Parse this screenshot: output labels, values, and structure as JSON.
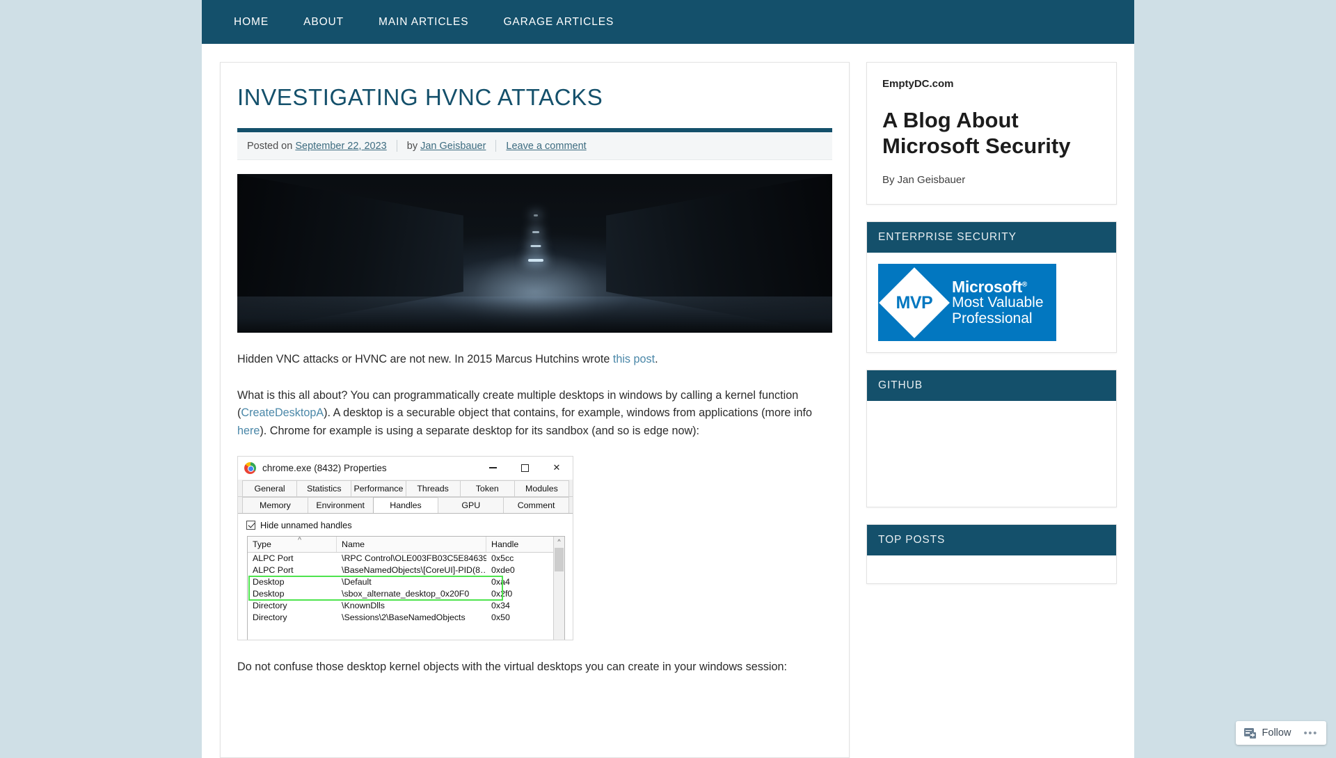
{
  "nav": {
    "items": [
      {
        "label": "Home",
        "name": "home"
      },
      {
        "label": "About",
        "name": "about"
      },
      {
        "label": "Main Articles",
        "name": "main-articles"
      },
      {
        "label": "Garage Articles",
        "name": "garage-articles"
      }
    ]
  },
  "post": {
    "title": "Investigating HVNC Attacks",
    "meta": {
      "posted_on_label": "Posted on",
      "date": "September 22, 2023",
      "by_label": "by",
      "author": "Jan Geisbauer",
      "comment_link": "Leave a comment"
    },
    "paragraphs": {
      "p1_a": "Hidden VNC attacks or HVNC are not new. In 2015 Marcus Hutchins wrote ",
      "p1_link": "this post",
      "p1_b": ".",
      "p2_a": "What is this all about? You can programmatically create multiple desktops in windows by calling a kernel function (",
      "p2_link1": "CreateDesktopA",
      "p2_b": "). A desktop is a securable object that contains, for example, windows from applications (more info ",
      "p2_link2": "here",
      "p2_c": "). Chrome for example is using a separate desktop for its sandbox (and so is edge now):",
      "p3": "Do not confuse those desktop kernel objects with the virtual desktops you can create in your windows session:"
    }
  },
  "screenshot": {
    "window_title": "chrome.exe (8432) Properties",
    "minimize_label": "—",
    "maximize_label": "□",
    "close_label": "✕",
    "tabs_row1": [
      "General",
      "Statistics",
      "Performance",
      "Threads",
      "Token",
      "Modules"
    ],
    "tabs_row2": [
      "Memory",
      "Environment",
      "Handles",
      "GPU",
      "Comment"
    ],
    "active_tab": "Handles",
    "checkbox_label": "Hide unnamed handles",
    "columns": [
      "Type",
      "Name",
      "Handle"
    ],
    "rows": [
      {
        "type": "ALPC Port",
        "name": "\\RPC Control\\OLE003FB03C5E84639…",
        "handle": "0x5cc",
        "highlight": false
      },
      {
        "type": "ALPC Port",
        "name": "\\BaseNamedObjects\\[CoreUI]-PID(8…",
        "handle": "0xde0",
        "highlight": false
      },
      {
        "type": "Desktop",
        "name": "\\Default",
        "handle": "0xa4",
        "highlight": true
      },
      {
        "type": "Desktop",
        "name": "\\sbox_alternate_desktop_0x20F0",
        "handle": "0x2f0",
        "highlight": true
      },
      {
        "type": "Directory",
        "name": "\\KnownDlls",
        "handle": "0x34",
        "highlight": false
      },
      {
        "type": "Directory",
        "name": "\\Sessions\\2\\BaseNamedObjects",
        "handle": "0x50",
        "highlight": false
      }
    ]
  },
  "sidebar": {
    "site_name": "EmptyDC.com",
    "blog_title": "A Blog About Microsoft Security",
    "blog_author": "By Jan Geisbauer",
    "widgets": [
      {
        "title": "Enterprise Security",
        "name": "enterprise-security"
      },
      {
        "title": "GitHub",
        "name": "github"
      },
      {
        "title": "Top Posts",
        "name": "top-posts"
      }
    ],
    "mvp_badge": {
      "diamond": "MVP",
      "line1": "Microsoft",
      "registered": "®",
      "line2": "Most Valuable",
      "line3": "Professional"
    }
  },
  "follow": {
    "label": "Follow",
    "more": "•••"
  },
  "colors": {
    "brand": "#14506b",
    "link": "#4a87a8",
    "mvp_blue": "#0277c0",
    "highlight_green": "#4ee44e"
  }
}
